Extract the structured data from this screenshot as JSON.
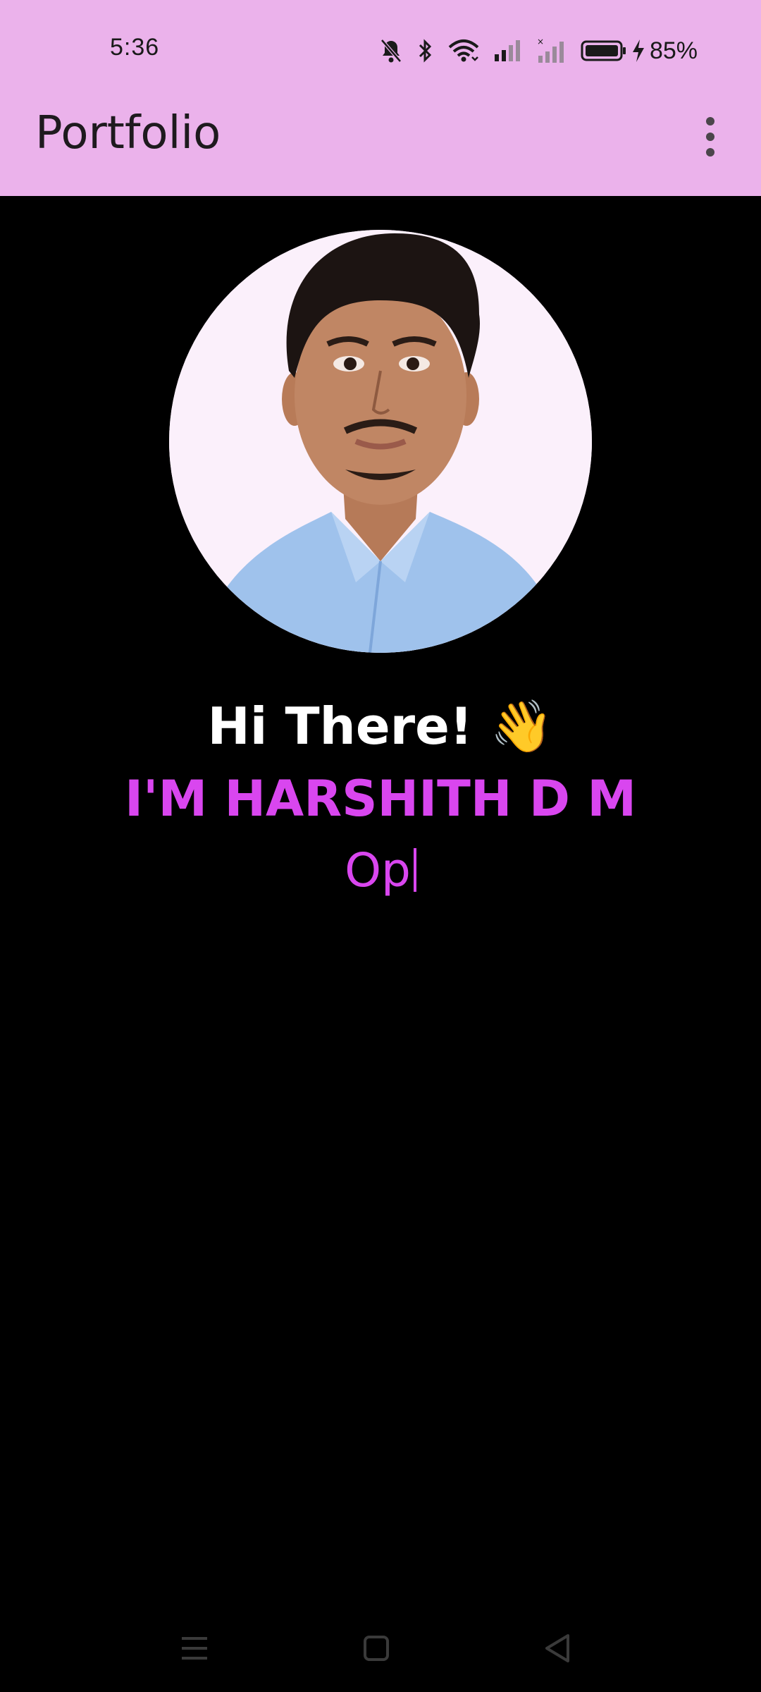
{
  "status_bar": {
    "time": "5:36",
    "battery_percent": "85%",
    "icons": [
      "bell-off-icon",
      "bluetooth-icon",
      "wifi-icon",
      "signal-icon",
      "signal-no-sim-icon",
      "battery-icon",
      "charging-icon"
    ]
  },
  "app_bar": {
    "title": "Portfolio",
    "menu_icon": "more-vert-icon"
  },
  "profile": {
    "greeting": "Hi There! 👋",
    "name": "I'M HARSHITH D M",
    "typing_text": "Op"
  },
  "nav_bar": {
    "icons": [
      "recents-icon",
      "home-icon",
      "back-icon"
    ]
  },
  "colors": {
    "app_bar": "#ebb2eb",
    "background": "#000000",
    "accent": "#d946ef"
  }
}
